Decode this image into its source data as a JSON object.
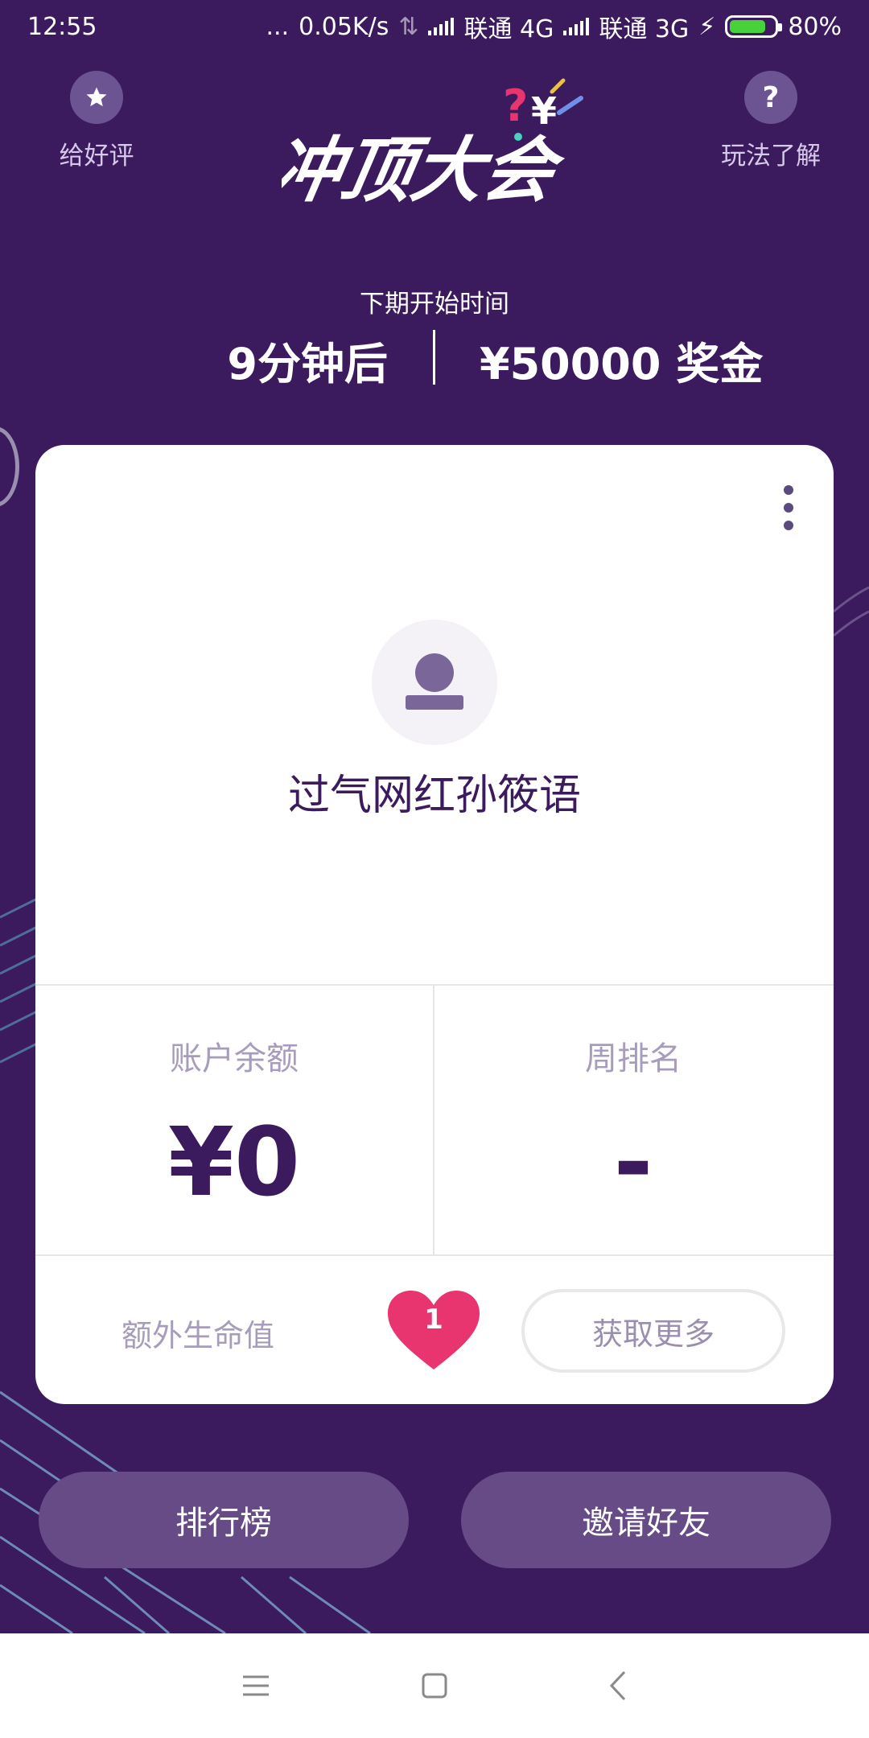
{
  "status_bar": {
    "time": "12:55",
    "dots": "...",
    "net_speed": "0.05K/s",
    "carrier1": "联通 4G",
    "carrier2": "联通 3G",
    "battery_percent": "80%",
    "battery_level": 0.8,
    "battery_color": "#49d13b"
  },
  "header": {
    "rate_label": "给好评",
    "rate_icon": "star-icon",
    "help_label": "玩法了解",
    "help_icon_glyph": "?",
    "logo_text": "冲顶大会"
  },
  "schedule": {
    "next_label": "下期开始时间",
    "countdown": "9分钟后",
    "prize": "¥50000 奖金"
  },
  "profile": {
    "username": "过气网红孙筱语",
    "balance_label": "账户余额",
    "balance_value": "¥0",
    "rank_label": "周排名",
    "rank_value": "-",
    "lives_label": "额外生命值",
    "lives_count": "1",
    "get_more_label": "获取更多"
  },
  "actions": {
    "leaderboard_label": "排行榜",
    "invite_label": "邀请好友"
  },
  "nav": {
    "menu_icon": "menu-icon",
    "home_icon": "home-square-icon",
    "back_icon": "back-chevron-icon"
  },
  "colors": {
    "background": "#3b1a5e",
    "card": "#ffffff",
    "accent_heart": "#e8346f",
    "button": "#664b86",
    "muted_text": "#a79cbc"
  }
}
